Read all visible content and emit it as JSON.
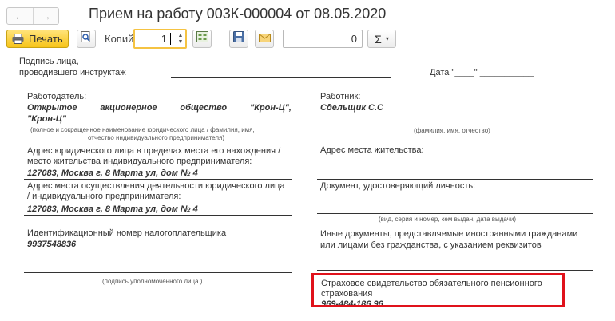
{
  "header": {
    "back_icon": "←",
    "forward_icon": "→",
    "title": "Прием на работу 003К-000004 от 08.05.2020"
  },
  "toolbar": {
    "print_label": "Печать",
    "copies_label": "Копий:",
    "copies_value": "1",
    "sum_value": "0",
    "sigma_label": "Σ",
    "sigma_dropdown": "▾"
  },
  "document": {
    "instructor_sign_line1": "Подпись лица,",
    "instructor_sign_line2": "проводившего инструктаж",
    "date_label": "Дата \"____\" ___________",
    "employer": {
      "label": "Работодатель:",
      "name_words": [
        "Открытое",
        "акционерное",
        "общество",
        "\"Крон-Ц\","
      ],
      "name_line2": "\"Крон-Ц\"",
      "name_caption_line1": "(полное и сокращенное наименование юридического лица / фамилия, имя,",
      "name_caption_line2": "отчество индивидуального предпринимателя)",
      "legal_address_line1": "Адрес юридического лица в пределах места его нахождения /",
      "legal_address_line2": "место жительства индивидуального предпринимателя:",
      "legal_address_value": "127083, Москва г, 8 Марта ул, дом № 4",
      "activity_address_line1": "Адрес места осуществления деятельности юридического лица",
      "activity_address_line2": "/ индивидуального предпринимателя:",
      "activity_address_value": "127083, Москва г, 8 Марта ул, дом № 4",
      "inn_label": "Идентификационный номер налогоплательщика",
      "inn_value": "9937548836",
      "signature_caption": "(подпись уполномоченного лица )"
    },
    "employee": {
      "label": "Работник:",
      "name": "Сдельщик С.С",
      "name_caption": "(фамилия, имя, отчество)",
      "residence_label": "Адрес места жительства:",
      "id_doc_label": "Документ, удостоверяющий личность:",
      "id_doc_caption": "(вид, серия и номер, кем выдан, дата выдачи)",
      "other_docs_line1": "Иные документы, представляемые иностранными гражданами",
      "other_docs_line2": "или лицами без гражданства, с указанием реквизитов",
      "pension_line1": "Страховое свидетельство обязательного пенсионного",
      "pension_line2": "страхования",
      "pension_value": "969-484-186 96"
    }
  },
  "colors": {
    "highlight": "#e0121b",
    "print_button": "#f7c419",
    "copies_focus": "#f5c342"
  }
}
